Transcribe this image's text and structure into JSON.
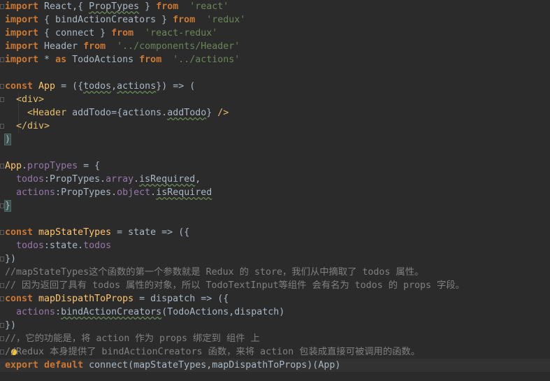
{
  "editor": {
    "language": "javascript-jsx",
    "theme": "darcula",
    "lines": [
      {
        "n": 1,
        "fold": true,
        "segs": [
          [
            "kw",
            "import"
          ],
          [
            "",
            "React,{ "
          ],
          [
            "warn",
            "PropTypes"
          ],
          [
            "",
            " } "
          ],
          [
            "kw",
            "from"
          ],
          [
            "str",
            " 'react'"
          ]
        ]
      },
      {
        "n": 2,
        "fold": false,
        "segs": [
          [
            "kw",
            "import"
          ],
          [
            "",
            "{ bindActionCreators } "
          ],
          [
            "kw",
            "from"
          ],
          [
            "str",
            " 'redux'"
          ]
        ]
      },
      {
        "n": 3,
        "fold": false,
        "segs": [
          [
            "kw",
            "import"
          ],
          [
            "",
            "{ connect } "
          ],
          [
            "kw",
            "from"
          ],
          [
            "str",
            " 'react-redux'"
          ]
        ]
      },
      {
        "n": 4,
        "fold": false,
        "segs": [
          [
            "kw",
            "import"
          ],
          [
            "",
            "Header "
          ],
          [
            "kw",
            "from"
          ],
          [
            "str",
            " '../components/Header'"
          ]
        ]
      },
      {
        "n": 5,
        "fold": true,
        "segs": [
          [
            "kw",
            "import"
          ],
          [
            "",
            "* "
          ],
          [
            "kw",
            "as"
          ],
          [
            "",
            "TodoActions "
          ],
          [
            "kw",
            "from"
          ],
          [
            "str",
            " '../actions'"
          ]
        ]
      },
      {
        "n": 6,
        "fold": false,
        "segs": []
      },
      {
        "n": 7,
        "fold": true,
        "segs": [
          [
            "kw",
            "const"
          ],
          [
            "fn",
            "App"
          ],
          [
            "",
            " = ({"
          ],
          [
            "warn",
            "todos"
          ],
          [
            "",
            ","
          ],
          [
            "warn",
            "actions"
          ],
          [
            "",
            "}) => ("
          ]
        ]
      },
      {
        "n": 8,
        "fold": true,
        "segs": [
          [
            "",
            "  "
          ],
          [
            "tag",
            "<div>"
          ]
        ]
      },
      {
        "n": 9,
        "fold": false,
        "segs": [
          [
            "",
            "    "
          ],
          [
            "tag",
            "<Header "
          ],
          [
            "",
            "addTodo="
          ],
          [
            "",
            "{actions."
          ],
          [
            "warn",
            "addTodo"
          ],
          [
            "",
            "} "
          ],
          [
            "tag",
            "/>"
          ]
        ]
      },
      {
        "n": 10,
        "fold": true,
        "segs": [
          [
            "",
            "  "
          ],
          [
            "tag",
            "</div>"
          ]
        ]
      },
      {
        "n": 11,
        "fold": false,
        "segs": [
          [
            "brace",
            ")"
          ]
        ]
      },
      {
        "n": 12,
        "fold": false,
        "segs": []
      },
      {
        "n": 13,
        "fold": true,
        "segs": [
          [
            "fn",
            "App"
          ],
          [
            "",
            "."
          ],
          [
            "prop",
            "propTypes"
          ],
          [
            "",
            " = {"
          ]
        ]
      },
      {
        "n": 14,
        "fold": false,
        "segs": [
          [
            "",
            "  "
          ],
          [
            "prop",
            "todos"
          ],
          [
            "",
            ":PropTypes."
          ],
          [
            "prop",
            "array"
          ],
          [
            "",
            "."
          ],
          [
            "warn",
            "isRequired"
          ],
          [
            "",
            ","
          ]
        ]
      },
      {
        "n": 15,
        "fold": false,
        "segs": [
          [
            "",
            "  "
          ],
          [
            "prop",
            "actions"
          ],
          [
            "",
            ":PropTypes."
          ],
          [
            "prop",
            "object"
          ],
          [
            "",
            "."
          ],
          [
            "warn",
            "isRequired"
          ]
        ]
      },
      {
        "n": 16,
        "fold": true,
        "segs": [
          [
            "brace",
            "}"
          ]
        ]
      },
      {
        "n": 17,
        "fold": false,
        "segs": []
      },
      {
        "n": 18,
        "fold": true,
        "segs": [
          [
            "kw",
            "const"
          ],
          [
            "fn",
            "mapStateTypes"
          ],
          [
            "",
            " = state => ({"
          ]
        ]
      },
      {
        "n": 19,
        "fold": false,
        "segs": [
          [
            "",
            "  "
          ],
          [
            "prop",
            "todos"
          ],
          [
            "",
            ":state."
          ],
          [
            "prop",
            "todos"
          ]
        ]
      },
      {
        "n": 20,
        "fold": true,
        "segs": [
          [
            "",
            "})"
          ]
        ]
      },
      {
        "n": 21,
        "fold": false,
        "segs": [
          [
            "com",
            "//mapStateTypes这个函数的第一个参数就是 Redux 的 store，我们从中摘取了 todos 属性。"
          ]
        ]
      },
      {
        "n": 22,
        "fold": true,
        "segs": [
          [
            "com",
            "// 因为返回了具有 todos 属性的对象，所以 TodoTextInput等组件 会有名为 todos 的 props 字段。"
          ]
        ]
      },
      {
        "n": 23,
        "fold": true,
        "segs": [
          [
            "kw",
            "const"
          ],
          [
            "fn",
            "mapDispathToProps"
          ],
          [
            "",
            " = dispatch => ({"
          ]
        ]
      },
      {
        "n": 24,
        "fold": false,
        "segs": [
          [
            "",
            "  "
          ],
          [
            "prop",
            "actions"
          ],
          [
            "",
            ":"
          ],
          [
            "warn",
            "bindActionCreators"
          ],
          [
            "",
            "(TodoActions,dispatch)"
          ]
        ]
      },
      {
        "n": 25,
        "fold": true,
        "segs": [
          [
            "",
            "})"
          ]
        ]
      },
      {
        "n": 26,
        "fold": true,
        "segs": [
          [
            "com",
            "//，它的功能是，将 action 作为 props 绑定到 组件 上"
          ]
        ]
      },
      {
        "n": 27,
        "fold": true,
        "segs": [
          [
            "com",
            "//Redux 本身提供了 bindActionCreators 函数，来将 action 包装成直接可被调用的函数。"
          ]
        ]
      },
      {
        "n": 28,
        "fold": false,
        "segs": [
          [
            "kw",
            "export default "
          ],
          [
            "",
            "connect(mapStateTypes,mapDispathToProps)(App)"
          ]
        ]
      }
    ],
    "current_line": 28,
    "intention_bulb_line": 27
  }
}
